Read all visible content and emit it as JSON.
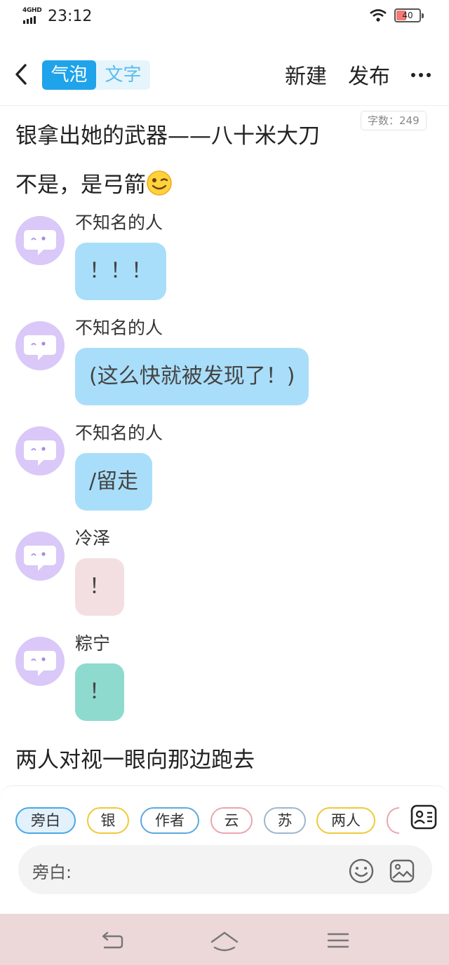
{
  "status_bar": {
    "network": "4GHD",
    "time": "23:12",
    "battery": "40",
    "battery_level": 0.4
  },
  "header": {
    "mode_bubble": "气泡",
    "mode_text": "文字",
    "active_mode": "气泡",
    "new_label": "新建",
    "publish_label": "发布",
    "word_count": "字数：249"
  },
  "story": {
    "line1": "银拿出她的武器——八十米大刀",
    "line2": "不是，是弓箭",
    "line2_emoji": "winking-face-emoji",
    "messages": [
      {
        "sender": "不知名的人",
        "text": "！！！",
        "color": "#a9defa"
      },
      {
        "sender": "不知名的人",
        "text": "(这么快就被发现了！)",
        "color": "#a9defa"
      },
      {
        "sender": "不知名的人",
        "text": "/留走",
        "color": "#a9defa"
      },
      {
        "sender": "冷泽",
        "text": "！",
        "color": "#f3dfe1"
      },
      {
        "sender": "粽宁",
        "text": "！",
        "color": "#8fdacf"
      }
    ],
    "line3": "两人对视一眼向那边跑去"
  },
  "input_panel": {
    "roles": [
      {
        "label": "旁白",
        "color": "#4aa8e6",
        "active": true
      },
      {
        "label": "银",
        "color": "#f0c93a"
      },
      {
        "label": "作者",
        "color": "#5aa9df"
      },
      {
        "label": "云",
        "color": "#e9a6ad"
      },
      {
        "label": "苏",
        "color": "#9fb6cc"
      },
      {
        "label": "两人",
        "color": "#f0c93a"
      },
      {
        "label": "",
        "color": "#e9a6ad"
      }
    ],
    "input_label": "旁白:",
    "placeholder": ""
  },
  "icons": {
    "back": "back-arrow-icon",
    "more": "more-icon",
    "avatar": "chat-bubble-face-icon",
    "role_list": "role-list-icon",
    "emoji": "emoji-icon",
    "image": "image-icon",
    "nav_back": "nav-back-icon",
    "nav_home": "nav-home-icon",
    "nav_menu": "nav-menu-icon"
  },
  "colors": {
    "accent": "#1fa3ea",
    "avatar_bg": "#d9c8f8",
    "nav_bar_bg": "#ecd7d9"
  }
}
